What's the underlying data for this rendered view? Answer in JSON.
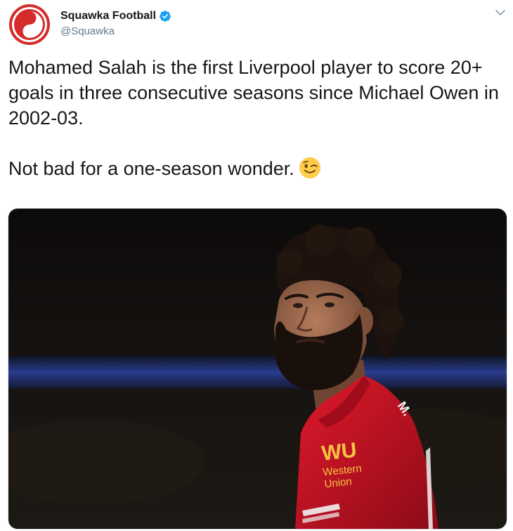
{
  "author": {
    "display_name": "Squawka Football",
    "handle": "@Squawka",
    "avatar_icon": "squawka-logo-icon",
    "verified_icon": "verified-badge-icon"
  },
  "menu": {
    "caret_icon": "chevron-down-icon"
  },
  "tweet": {
    "paragraph_1": "Mohamed Salah is the first Liverpool player to score 20+ goals in three consecutive seasons since Michael Owen in 2002-03.",
    "paragraph_2": "Not bad for a one-season wonder.",
    "emoji": "winking-face-emoji"
  },
  "media": {
    "kit_sponsor": "WU",
    "sponsor_line1": "Western",
    "sponsor_line2": "Union",
    "shirt_name": "M."
  },
  "colors": {
    "brand_red": "#d52b2b",
    "verified_blue": "#1da1f2",
    "text": "#14171a",
    "secondary_text": "#657786",
    "shirt_red": "#c8102e",
    "sponsor_gold": "#f6c344"
  }
}
